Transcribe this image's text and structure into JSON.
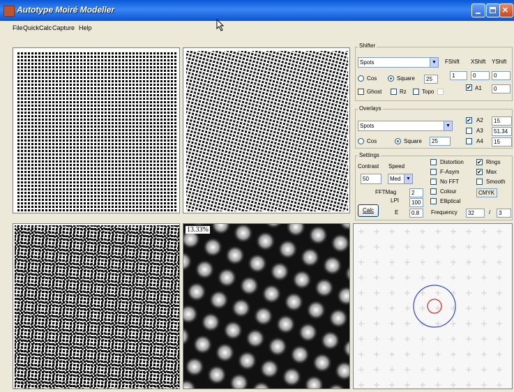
{
  "window": {
    "title": "Autotype Moiré Modeller"
  },
  "menu": [
    "File",
    "QuickCalc",
    "Capture",
    "Help"
  ],
  "shifter": {
    "group_label": "Shifter",
    "pattern": "Spots",
    "fshift_label": "FShift",
    "xshift_label": "XShift",
    "yshift_label": "YShift",
    "fshift": "1",
    "xshift": "0",
    "yshift": "0",
    "cos_label": "Cos",
    "square_label": "Square",
    "square_value": "25",
    "ghost_label": "Ghost",
    "rz_label": "Rz",
    "topo_label": "Topo",
    "a1_label": "A1",
    "a1_value": "0"
  },
  "overlays": {
    "group_label": "Overlays",
    "pattern": "Spots",
    "cos_label": "Cos",
    "square_label": "Square",
    "square_value": "25",
    "a2_label": "A2",
    "a2_value": "15",
    "a3_label": "A3",
    "a3_value": "51.34",
    "a4_label": "A4",
    "a4_value": "15"
  },
  "settings": {
    "group_label": "Settings",
    "contrast_label": "Contrast",
    "contrast_value": "50",
    "speed_label": "Speed",
    "speed_value": "Med",
    "fftmag_label": "FFTMag",
    "fftmag_value": "2",
    "lpi_label": "LPI",
    "lpi_value": "100",
    "e_label": "E",
    "e_value": "0.8",
    "calc_label": "Calc",
    "frequency_label": "Frequency",
    "freq_num": "32",
    "freq_sep": "/",
    "freq_den": "3",
    "checks": {
      "distortion": "Distortion",
      "fasym": "F-Asym",
      "nofft": "No FFT",
      "colour": "Colour",
      "elliptical": "Elliptical",
      "rings": "Rings",
      "max": "Max",
      "smooth": "Smooth"
    },
    "cmyk_value": "CMYK"
  },
  "preview": {
    "percent_label": "13.33%"
  },
  "colors": {
    "ring_outer": "#3344cc",
    "ring_inner": "#dd2222"
  }
}
